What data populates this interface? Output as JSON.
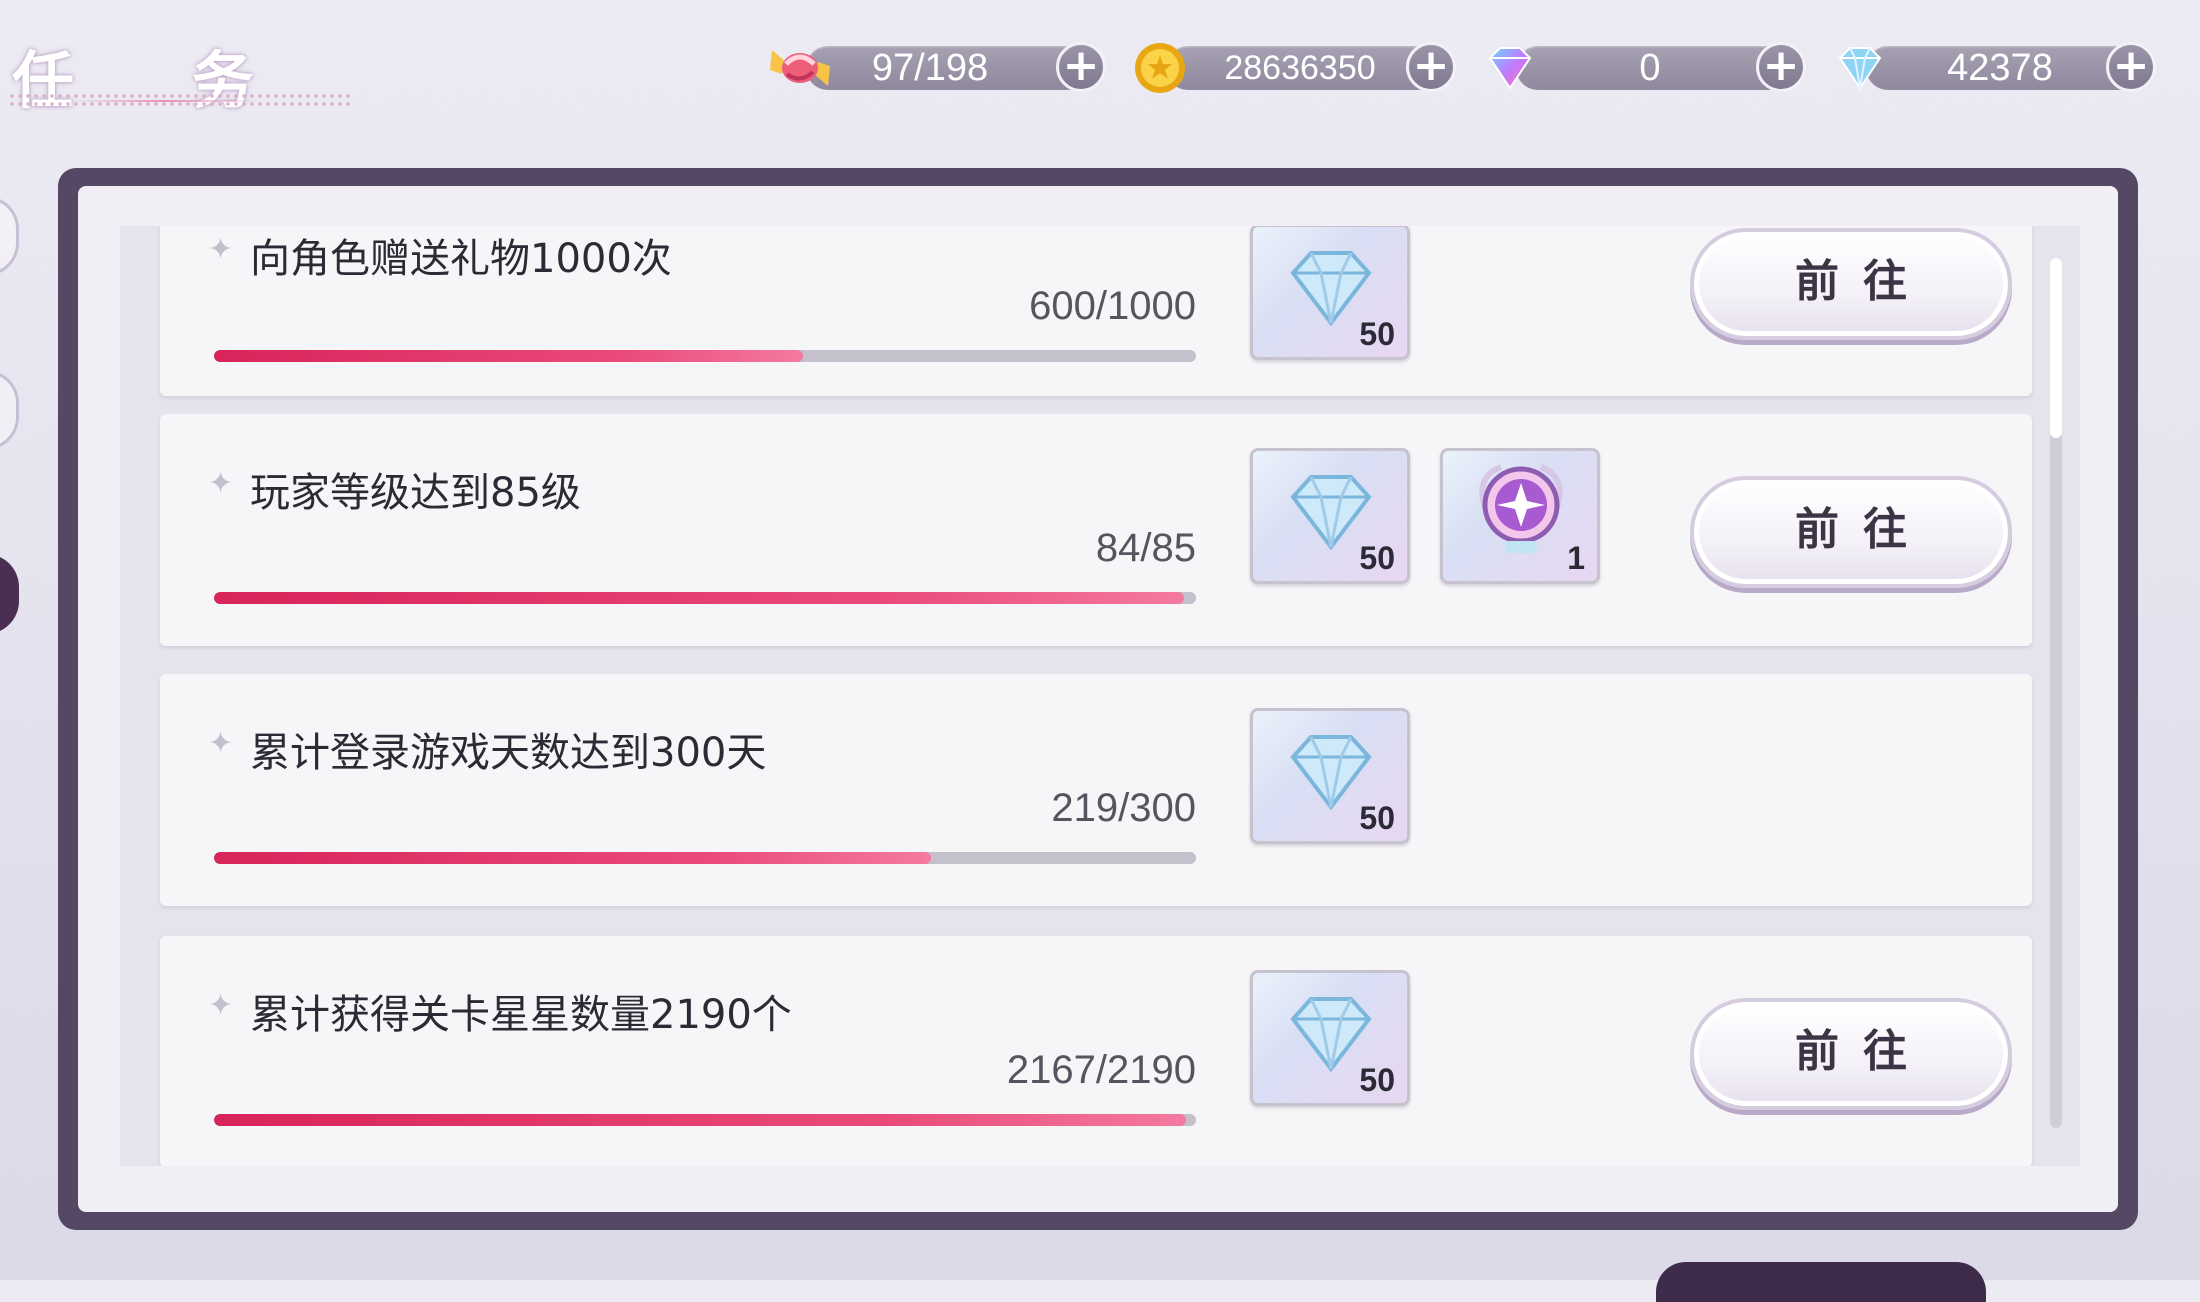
{
  "header": {
    "title": "任 务"
  },
  "currencies": [
    {
      "id": "candy",
      "icon": "candy-icon",
      "value": "97/198"
    },
    {
      "id": "coin",
      "icon": "gold-coin-icon",
      "value": "28636350"
    },
    {
      "id": "color-diamond",
      "icon": "rainbow-diamond-icon",
      "value": "0"
    },
    {
      "id": "diamond",
      "icon": "blue-diamond-icon",
      "value": "42378"
    }
  ],
  "tasks": [
    {
      "name": "向角色赠送礼物1000次",
      "progress_text": "600/1000",
      "progress": 0.6,
      "rewards": [
        {
          "icon": "diamond-reward-icon",
          "qty": "50"
        }
      ],
      "button": "前往"
    },
    {
      "name": "玩家等级达到85级",
      "progress_text": "84/85",
      "progress": 0.988,
      "rewards": [
        {
          "icon": "diamond-reward-icon",
          "qty": "50"
        },
        {
          "icon": "crystal-orb-icon",
          "qty": "1"
        }
      ],
      "button": "前往"
    },
    {
      "name": "累计登录游戏天数达到300天",
      "progress_text": "219/300",
      "progress": 0.73,
      "rewards": [
        {
          "icon": "diamond-reward-icon",
          "qty": "50"
        }
      ],
      "button": ""
    },
    {
      "name": "累计获得关卡星星数量2190个",
      "progress_text": "2167/2190",
      "progress": 0.99,
      "rewards": [
        {
          "icon": "diamond-reward-icon",
          "qty": "50"
        }
      ],
      "button": "前往"
    }
  ],
  "scroll": {
    "position": 0
  },
  "colors": {
    "accent": "#e33d6c",
    "frame": "#544864"
  }
}
